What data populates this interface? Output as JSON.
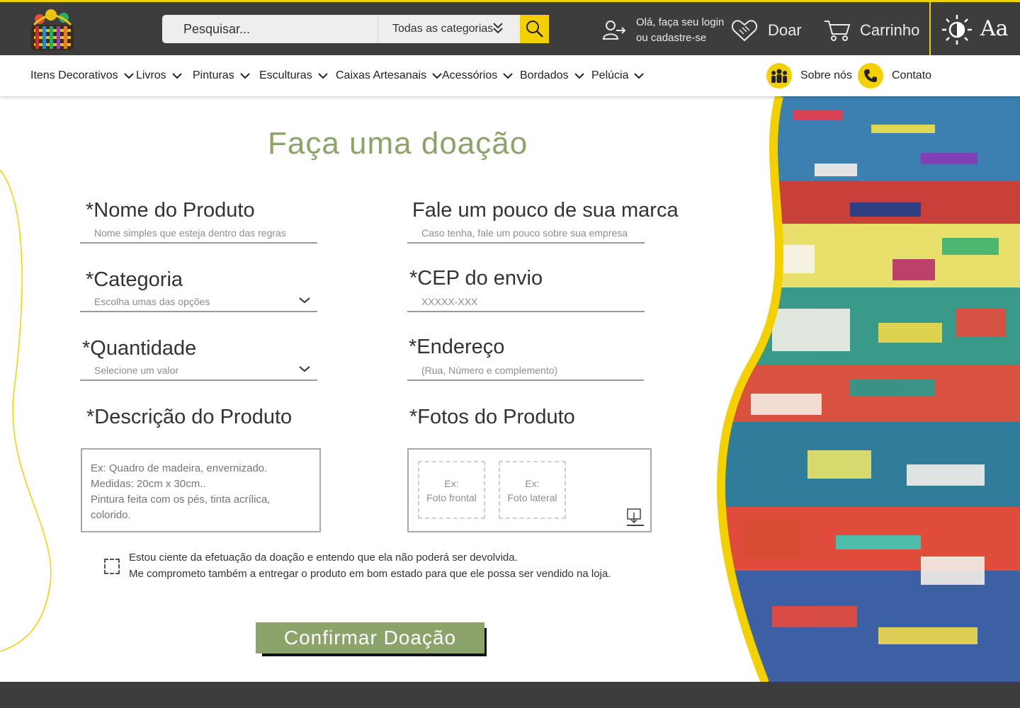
{
  "header": {
    "search_placeholder": "Pesquisar...",
    "category_select": "Todas as categorias",
    "login_line1": "Olá, faça seu login",
    "login_line2": "ou cadastre-se",
    "donate_label": "Doar",
    "cart_label": "Carrinho",
    "font_toggle": "Aa"
  },
  "nav": {
    "items": [
      {
        "label": "Itens Decorativos"
      },
      {
        "label": "Livros"
      },
      {
        "label": "Pinturas"
      },
      {
        "label": "Esculturas"
      },
      {
        "label": "Caixas Artesanais"
      },
      {
        "label": "Acessórios"
      },
      {
        "label": "Bordados"
      },
      {
        "label": "Pelúcia"
      }
    ],
    "about_label": "Sobre nós",
    "contact_label": "Contato"
  },
  "form": {
    "title": "Faça uma doação",
    "product_name": {
      "label": "*Nome do Produto",
      "placeholder": "Nome simples que esteja dentro das regras"
    },
    "brand": {
      "label": "Fale um pouco de sua marca",
      "placeholder": "Caso tenha, fale um pouco sobre sua empresa"
    },
    "category": {
      "label": "*Categoria",
      "placeholder": "Escolha umas das opções"
    },
    "cep": {
      "label": "*CEP do envio",
      "placeholder": "XXXXX-XXX"
    },
    "quantity": {
      "label": "*Quantidade",
      "placeholder": "Selecione um valor"
    },
    "address": {
      "label": "*Endereço",
      "placeholder": "(Rua, Número e complemento)"
    },
    "description": {
      "label": "*Descrição do Produto",
      "placeholder": "Ex: Quadro de madeira, envernizado.\nMedidas: 20cm x 30cm..\nPintura feita com os pés, tinta acrílica, colorido."
    },
    "photos": {
      "label": "*Fotos do Produto",
      "slot1_line1": "Ex:",
      "slot1_line2": "Foto frontal",
      "slot2_line1": "Ex:",
      "slot2_line2": "Foto lateral"
    },
    "terms_line1": "Estou ciente da efetuação da doação e entendo que ela não poderá ser devolvida.",
    "terms_line2": "Me comprometo também a entregar o produto em bom estado para que ele possa ser vendido na loja.",
    "submit_label": "Confirmar Doação"
  },
  "colors": {
    "accent_yellow": "#f3d100",
    "header_bg": "#3d3d3d",
    "title_green": "#8ca46a"
  }
}
